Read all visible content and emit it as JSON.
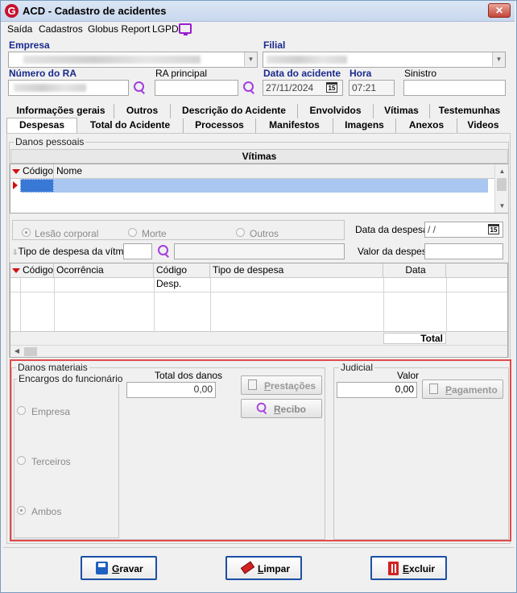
{
  "window": {
    "title": "ACD - Cadastro de acidentes",
    "logo_letter": "G",
    "close": "✕"
  },
  "menu": {
    "items": [
      "Saída",
      "Cadastros",
      "Globus Report",
      "LGPD"
    ]
  },
  "header": {
    "empresa_label": "Empresa",
    "filial_label": "Filial",
    "numero_ra_label": "Número do RA",
    "ra_principal_label": "RA principal",
    "data_acidente_label": "Data do acidente",
    "data_acidente_value": "27/11/2024",
    "hora_label": "Hora",
    "hora_value": "07:21",
    "sinistro_label": "Sinistro",
    "calendar_glyph": "15"
  },
  "tabs_row1": [
    "Informações gerais",
    "Outros",
    "Descrição do Acidente",
    "Envolvidos",
    "Vítimas",
    "Testemunhas"
  ],
  "tabs_row2": [
    "Despesas",
    "Total do Acidente",
    "Processos",
    "Manifestos",
    "Imagens",
    "Anexos",
    "Videos"
  ],
  "danos_pessoais": {
    "title": "Danos pessoais",
    "vitimas_header": "Vítimas",
    "vitimas_columns": [
      "Código",
      "Nome"
    ],
    "radios": [
      "Lesão corporal",
      "Morte",
      "Outros"
    ],
    "tipo_despesa_label": "Tipo de despesa da vítma.",
    "data_despesa_label": "Data da despesa",
    "data_despesa_value": " /  /",
    "valor_despesa_label": "Valor da despesa",
    "despesas_columns": [
      "Código",
      "Ocorrência",
      "Código Desp.",
      "Tipo de despesa",
      "Data"
    ],
    "total_label": "Total"
  },
  "danos_materiais": {
    "title": "Danos materiais",
    "encargos_title": "Encargos do funcionário",
    "encargos_options": [
      "Empresa",
      "Terceiros",
      "Ambos"
    ],
    "total_danos_label": "Total dos danos",
    "total_danos_value": "0,00",
    "prestacoes_button": "Prestações",
    "recibo_button": "Recibo"
  },
  "judicial": {
    "title": "Judicial",
    "valor_label": "Valor",
    "valor_value": "0,00",
    "pagamento_button": "Pagamento"
  },
  "footer": {
    "gravar": "Gravar",
    "limpar": "Limpar",
    "excluir": "Excluir"
  }
}
